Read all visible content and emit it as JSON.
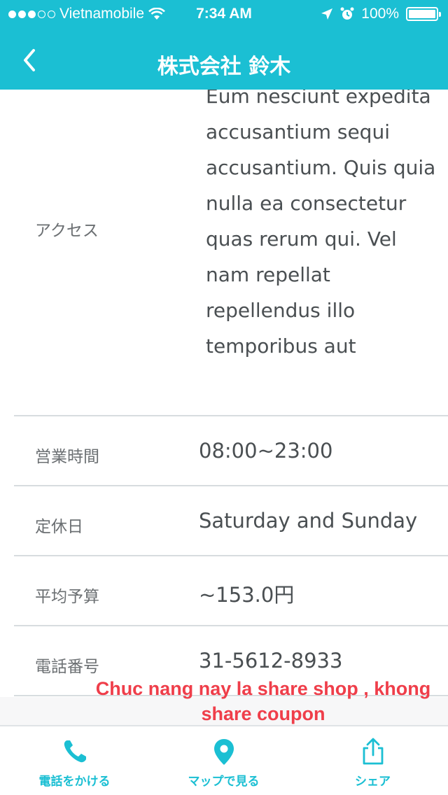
{
  "status_bar": {
    "carrier": "Vietnamobile",
    "time": "7:34 AM",
    "battery": "100%",
    "signal_bars_filled": 3,
    "signal_bars_total": 5
  },
  "nav": {
    "title": "株式会社 鈴木",
    "back_icon": "chevron-left-icon"
  },
  "access": {
    "label": "アクセス",
    "text": "Eum nesciunt expedita accusantium sequi accusantium. Quis quia nulla ea consectetur quas rerum qui. Vel nam repellat repellendus illo temporibus aut"
  },
  "rows": [
    {
      "label": "営業時間",
      "value": "08:00~23:00"
    },
    {
      "label": "定休日",
      "value": "Saturday and Sunday"
    },
    {
      "label": "平均予算",
      "value": "~153.0円"
    },
    {
      "label": "電話番号",
      "value": "31-5612-8933"
    }
  ],
  "note": {
    "line1": "Chuc nang nay la share shop , khong",
    "line2": "share coupon"
  },
  "tabbar": {
    "call_label": "電話をかける",
    "map_label": "マップで見る",
    "share_label": "シェア"
  },
  "colors": {
    "accent": "#1bbfd3",
    "note_red": "#ef3e4a",
    "text": "#4a4f52"
  }
}
